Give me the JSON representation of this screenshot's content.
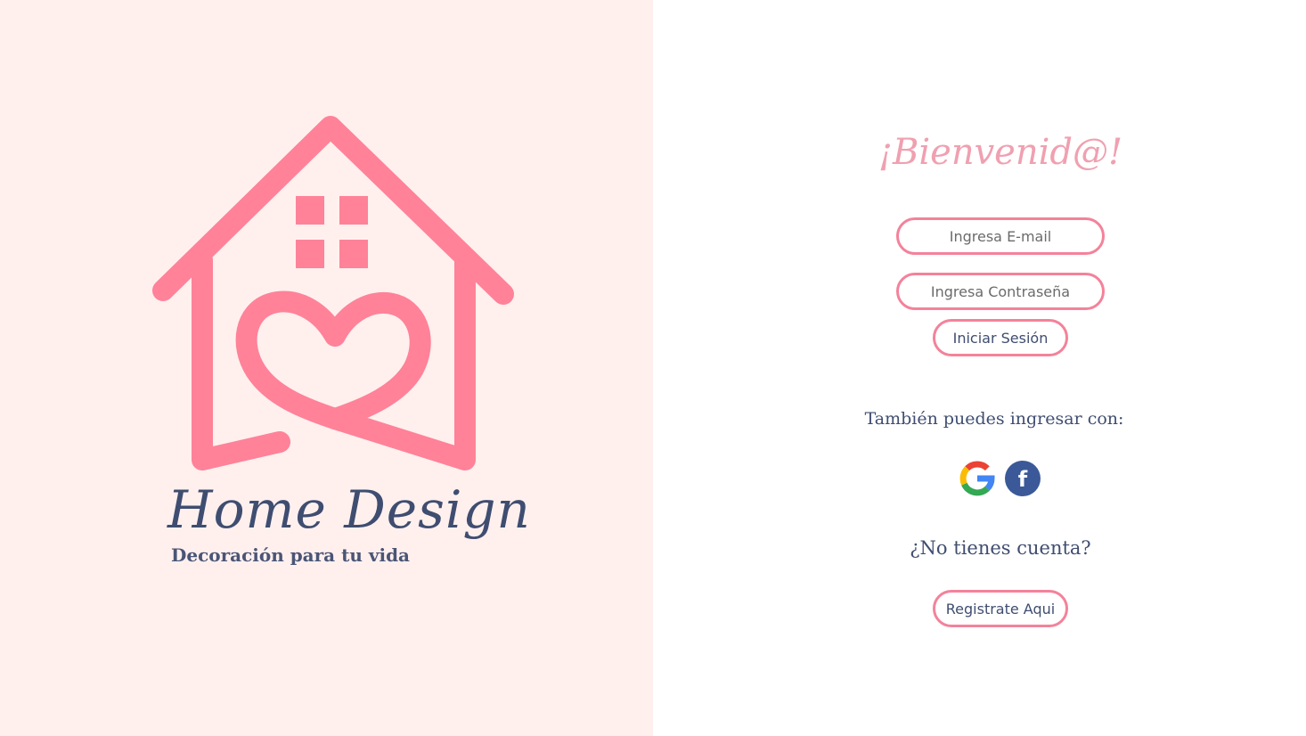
{
  "brand": {
    "name": "Home Design",
    "tagline": "Decoración para tu vida"
  },
  "login": {
    "title": "¡Bienvenid@!",
    "email_placeholder": "Ingresa E-mail",
    "password_placeholder": "Ingresa Contraseña",
    "submit_label": "Iniciar Sesión"
  },
  "social": {
    "prompt": "También puedes ingresar con:",
    "providers": [
      "google",
      "facebook"
    ],
    "facebook_glyph": "f"
  },
  "register": {
    "prompt": "¿No tienes cuenta?",
    "button_label": "Registrate Aqui"
  },
  "colors": {
    "left_bg": "#fff0ee",
    "accent_pink": "#f4829a",
    "title_pink": "#f0a0b0",
    "text_navy": "#3f4d70",
    "facebook_blue": "#3b5998"
  }
}
